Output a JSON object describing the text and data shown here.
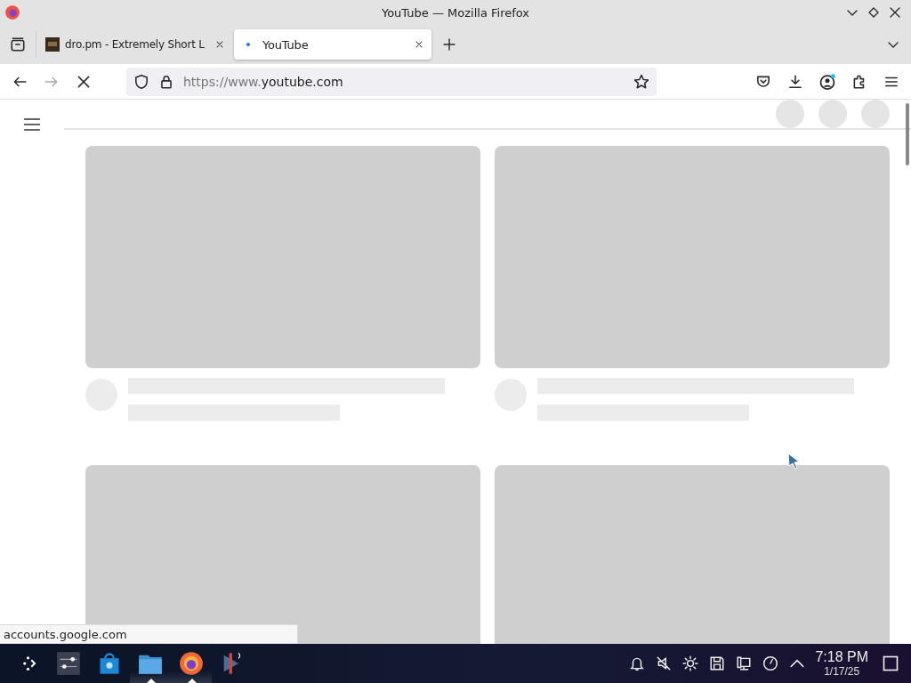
{
  "window": {
    "title": "YouTube — Mozilla Firefox"
  },
  "tabs": [
    {
      "label": "dro.pm - Extremely Short L",
      "selected": false
    },
    {
      "label": "YouTube",
      "selected": true
    }
  ],
  "navigation": {
    "loading": true,
    "url_prefix": "https://www.",
    "url_domain": "youtube.com"
  },
  "status_bar": {
    "text": "accounts.google.com"
  },
  "taskbar": {
    "apps": [
      {
        "kind": "mixer",
        "running": false
      },
      {
        "kind": "store",
        "running": false
      },
      {
        "kind": "files",
        "running": true
      },
      {
        "kind": "firefox",
        "running": true
      },
      {
        "kind": "presenter",
        "running": false
      }
    ],
    "time": "7:18 PM",
    "date": "1/17/25"
  }
}
